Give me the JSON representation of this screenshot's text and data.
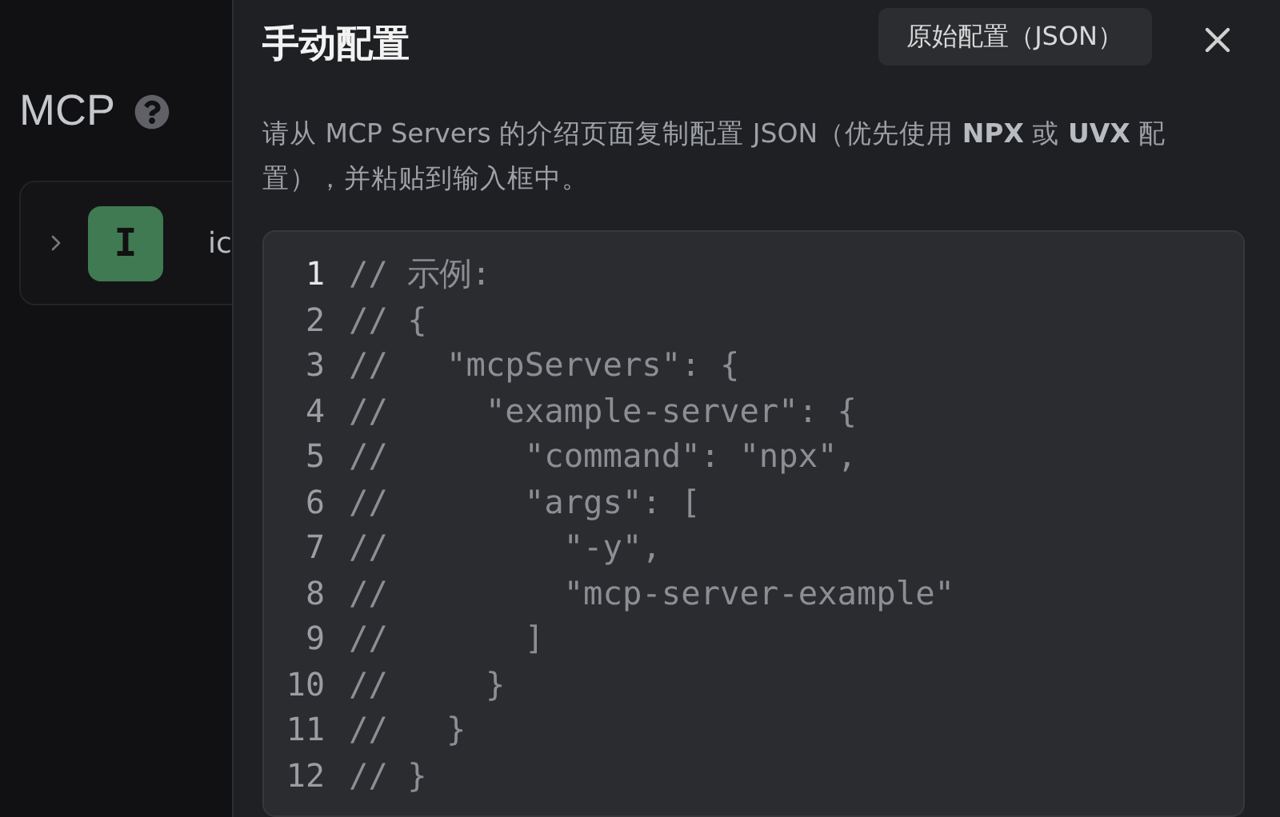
{
  "page": {
    "title": "MCP",
    "servers": [
      {
        "avatar": "I",
        "name": "ic",
        "expanded": false
      }
    ]
  },
  "dialog": {
    "title": "手动配置",
    "raw_button": "原始配置（JSON）",
    "description": "请从 MCP Servers 的介绍页面复制配置 JSON（优先使用 **NPX** 或 **UVX** 配置），并粘贴到输入框中。",
    "editor": {
      "lines": [
        {
          "number": "1",
          "code": "// 示例:",
          "active": true
        },
        {
          "number": "2",
          "code": "// {",
          "active": false
        },
        {
          "number": "3",
          "code": "//   \"mcpServers\": {",
          "active": false
        },
        {
          "number": "4",
          "code": "//     \"example-server\": {",
          "active": false
        },
        {
          "number": "5",
          "code": "//       \"command\": \"npx\",",
          "active": false
        },
        {
          "number": "6",
          "code": "//       \"args\": [",
          "active": false
        },
        {
          "number": "7",
          "code": "//         \"-y\",",
          "active": false
        },
        {
          "number": "8",
          "code": "//         \"mcp-server-example\"",
          "active": false
        },
        {
          "number": "9",
          "code": "//       ]",
          "active": false
        },
        {
          "number": "10",
          "code": "//     }",
          "active": false
        },
        {
          "number": "11",
          "code": "//   }",
          "active": false
        },
        {
          "number": "12",
          "code": "// }",
          "active": false
        }
      ]
    }
  }
}
